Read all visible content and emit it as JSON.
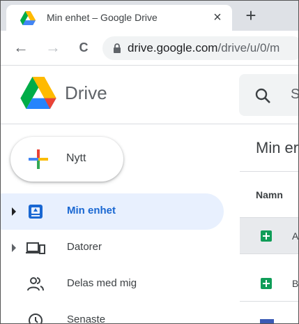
{
  "browser": {
    "tab_title": "Min enhet – Google Drive",
    "tab_close": "×",
    "new_tab": "+",
    "nav": {
      "back": "←",
      "forward": "→",
      "reload": "C"
    },
    "url_host": "drive.google.com",
    "url_path": "/drive/u/0/m"
  },
  "drive": {
    "brand": "Drive",
    "search_placeholder": "S"
  },
  "sidebar": {
    "new_label": "Nytt",
    "items": [
      {
        "label": "Min enhet",
        "icon": "my-drive-icon",
        "active": true,
        "expandable": true
      },
      {
        "label": "Datorer",
        "icon": "computers-icon",
        "active": false,
        "expandable": true
      },
      {
        "label": "Delas med mig",
        "icon": "shared-with-me-icon",
        "active": false,
        "expandable": false
      },
      {
        "label": "Senaste",
        "icon": "recent-icon",
        "active": false,
        "expandable": false
      }
    ]
  },
  "main": {
    "title": "Min er",
    "column_name": "Namn",
    "rows": [
      {
        "name": "A",
        "icon": "sheets-icon",
        "selected": true
      },
      {
        "name": "B",
        "icon": "sheets-icon",
        "selected": false
      }
    ]
  },
  "colors": {
    "accent": "#1967d2",
    "active_bg": "#e8f0fe",
    "sheets_green": "#0f9d58",
    "tab_strip": "#dee1e6"
  }
}
